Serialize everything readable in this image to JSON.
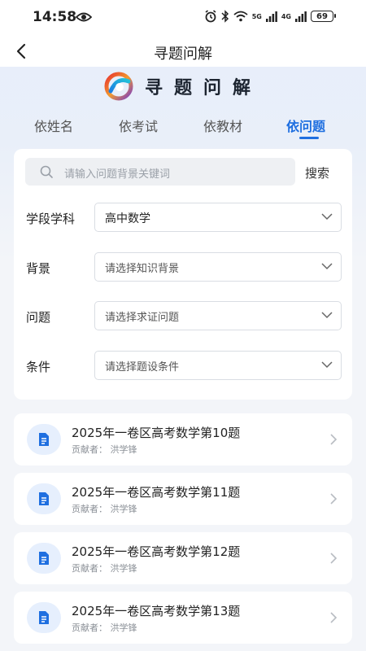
{
  "status": {
    "time": "14:58",
    "net1": "5G",
    "net2": "4G",
    "battery": "69"
  },
  "nav": {
    "title": "寻题问解"
  },
  "brand": {
    "title": "寻题问解"
  },
  "tabs": [
    {
      "label": "依姓名"
    },
    {
      "label": "依考试"
    },
    {
      "label": "依教材"
    },
    {
      "label": "依问题"
    }
  ],
  "search": {
    "placeholder": "请输入问题背景关键词",
    "button": "搜索"
  },
  "filters": [
    {
      "label": "学段学科",
      "value": "高中数学"
    },
    {
      "label": "背景",
      "value": "请选择知识背景"
    },
    {
      "label": "问题",
      "value": "请选择求证问题"
    },
    {
      "label": "条件",
      "value": "请选择题设条件"
    }
  ],
  "results": [
    {
      "title": "2025年一卷区高考数学第10题",
      "contributor": "贡献者： 洪学锋"
    },
    {
      "title": "2025年一卷区高考数学第11题",
      "contributor": "贡献者： 洪学锋"
    },
    {
      "title": "2025年一卷区高考数学第12题",
      "contributor": "贡献者： 洪学锋"
    },
    {
      "title": "2025年一卷区高考数学第13题",
      "contributor": "贡献者： 洪学锋"
    }
  ],
  "colors": {
    "accent": "#1f6fe0",
    "page_bg": "#f3f5f9"
  }
}
